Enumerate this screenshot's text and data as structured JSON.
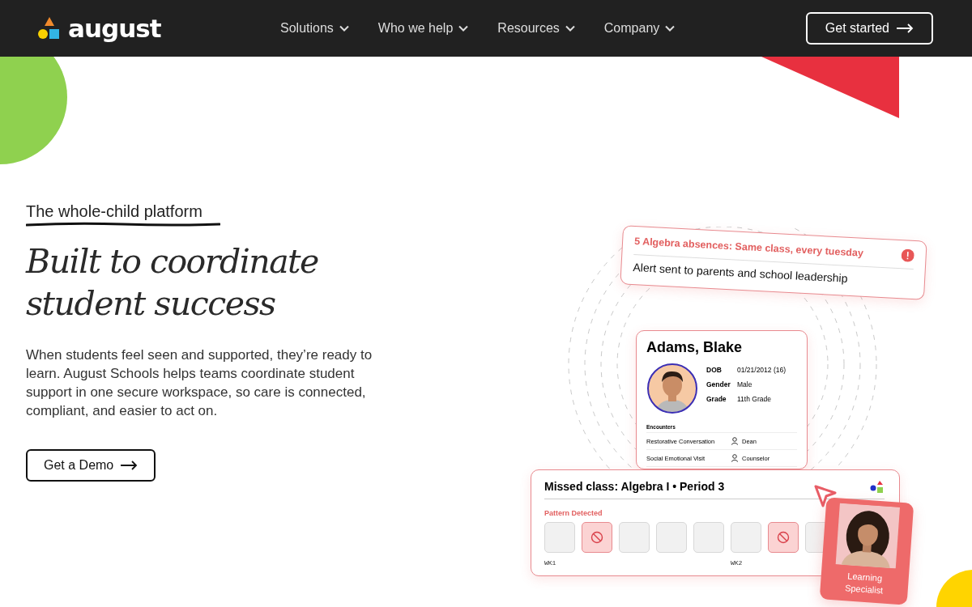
{
  "header": {
    "logo": "august",
    "nav": [
      {
        "label": "Solutions"
      },
      {
        "label": "Who we help"
      },
      {
        "label": "Resources"
      },
      {
        "label": "Company"
      }
    ],
    "cta": "Get started"
  },
  "hero": {
    "eyebrow": "The whole-child platform",
    "title_lines": [
      "Built to coordinate",
      "student success"
    ],
    "body": "When students feel seen and supported, they’re ready to learn. August Schools helps teams coordinate student support in one secure workspace, so care is connected, compliant, and easier to act on.",
    "button": "Get a Demo"
  },
  "alert_card": {
    "title": "5 Algebra absences: Same class, every tuesday",
    "message": "Alert sent to parents and school leadership"
  },
  "student_card": {
    "name": "Adams, Blake",
    "fields": [
      {
        "label": "DOB",
        "value": "01/21/2012 (16)"
      },
      {
        "label": "Gender",
        "value": "Male"
      },
      {
        "label": "Grade",
        "value": "11th Grade"
      }
    ],
    "encounters_title": "Encounters",
    "encounters": [
      {
        "type": "Restorative Conversation",
        "role": "Dean"
      },
      {
        "type": "Social Emotional Visit",
        "role": "Counselor"
      }
    ]
  },
  "missed_card": {
    "title": "Missed class: Algebra I • Period 3",
    "pattern": "Pattern Detected",
    "days": [
      {
        "absent": false,
        "week": "WK1"
      },
      {
        "absent": true
      },
      {
        "absent": false
      },
      {
        "absent": false
      },
      {
        "absent": false
      },
      {
        "absent": false,
        "week": "WK2"
      },
      {
        "absent": true
      },
      {
        "absent": false
      }
    ]
  },
  "specialist_card": {
    "label": "Learning Specialist"
  }
}
